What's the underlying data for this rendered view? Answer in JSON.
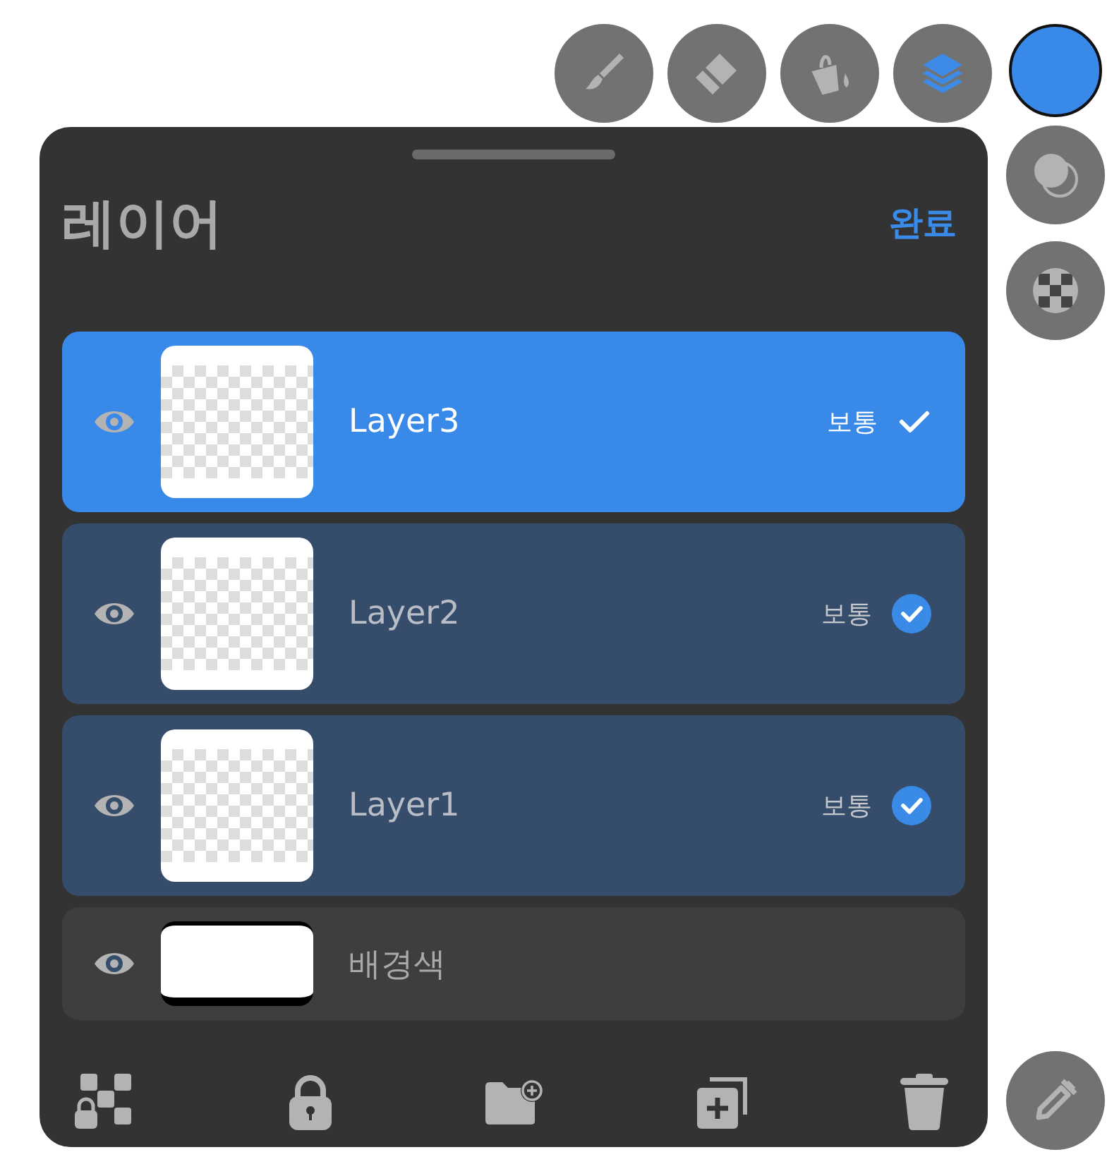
{
  "tools": [
    {
      "kind": "brush",
      "selected": false
    },
    {
      "kind": "eraser",
      "selected": false
    },
    {
      "kind": "fill",
      "selected": false
    },
    {
      "kind": "layers",
      "selected": true
    }
  ],
  "color_swatch": {
    "color": "#3889e8"
  },
  "panel": {
    "title": "레이어",
    "done_button": "완료",
    "layers": [
      {
        "kind": "layer",
        "name": "Layer3",
        "blend": "보통",
        "visible": true,
        "selected": true,
        "checked": true
      },
      {
        "kind": "layer",
        "name": "Layer2",
        "blend": "보통",
        "visible": true,
        "selected": false,
        "checked": true
      },
      {
        "kind": "layer",
        "name": "Layer1",
        "blend": "보통",
        "visible": true,
        "selected": false,
        "checked": true
      },
      {
        "kind": "background",
        "name": "배경색",
        "visible": true,
        "selected": false
      }
    ]
  }
}
